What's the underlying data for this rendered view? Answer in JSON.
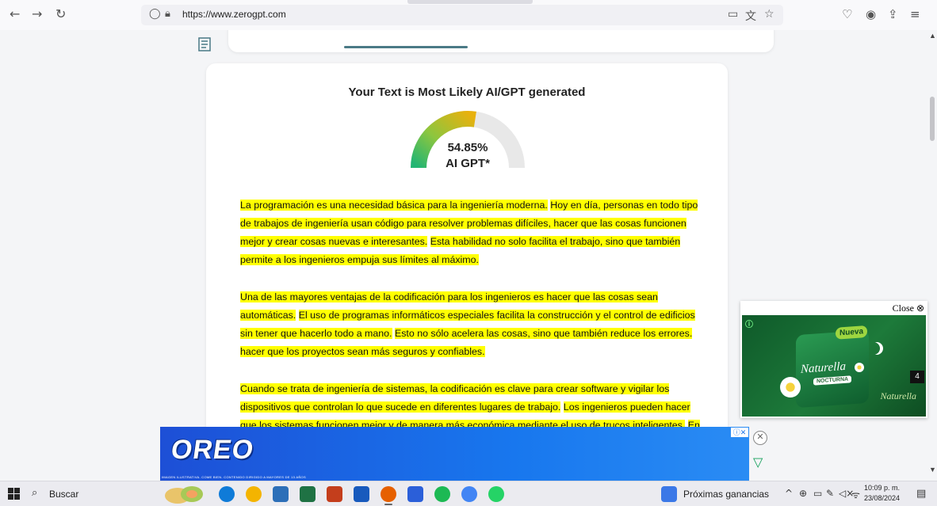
{
  "browser": {
    "back_icon": "arrow-left-icon",
    "forward_icon": "arrow-right-icon",
    "reload_icon": "reload-icon",
    "url": "https://www.zerogpt.com"
  },
  "result": {
    "title": "Your Text is Most Likely AI/GPT generated",
    "percentage": "54.85%",
    "percentage_value": 54.85,
    "gauge_label": "AI GPT*",
    "gauge_colors": [
      "#22b573",
      "#8cc63f",
      "#e8b10e",
      "#e8e8e8"
    ]
  },
  "paragraphs": [
    [
      {
        "text": "La programación es una necesidad básica para la ingeniería moderna.",
        "hl": true
      },
      {
        "text": " ",
        "hl": false
      },
      {
        "text": "Hoy en día, personas en todo tipo de trabajos de ingeniería usan código para resolver problemas difíciles, hacer que las cosas funcionen mejor y crear cosas nuevas e interesantes.",
        "hl": true
      },
      {
        "text": " ",
        "hl": false
      },
      {
        "text": "Esta habilidad no solo facilita el trabajo, sino que también permite a los ingenieros empuja sus límites al máximo.",
        "hl": true
      }
    ],
    [
      {
        "text": "Una de las mayores ventajas de la codificación para los ingenieros es hacer que las cosas sean automáticas.",
        "hl": true
      },
      {
        "text": " ",
        "hl": false
      },
      {
        "text": "El uso de programas informáticos especiales facilita la construcción y el control de edificios sin tener que hacerlo todo a mano.",
        "hl": true
      },
      {
        "text": " ",
        "hl": false
      },
      {
        "text": "Esto no sólo acelera las cosas, sino que también reduce los errores. hacer que los proyectos sean más seguros y confiables.",
        "hl": true
      }
    ],
    [
      {
        "text": "Cuando se trata de ingeniería de sistemas, la codificación es clave para crear software y vigilar los dispositivos que controlan lo que sucede en diferentes lugares de trabajo.",
        "hl": true
      },
      {
        "text": " ",
        "hl": false
      },
      {
        "text": "Los ingenieros pueden hacer que los sistemas funcionen mejor y de manera más económica mediante el uso de trucos inteligentes.",
        "hl": true
      },
      {
        "text": " ",
        "hl": false
      },
      {
        "text": "En",
        "hl": true
      }
    ]
  ],
  "video_ad": {
    "close_label": "Close ⊗",
    "info": "ⓘ",
    "badge": "Nueva",
    "brand": "Naturella",
    "sub": "NOCTURNA",
    "counter": "4"
  },
  "bottom_ad": {
    "brand": "OREO",
    "disclaimer": "IMAGEN ILUSTRATIVA. COME BIEN. CONTENIDO DIRIGIDO A MAYORES DE 13 AÑOS",
    "adchoices": "ⓘ✕"
  },
  "taskbar": {
    "search_label": "Buscar",
    "news_label": "Próximas ganancias",
    "time": "10:09 p. m.",
    "date": "23/08/2024",
    "app_colors": [
      "#0f7bd8",
      "#f4b400",
      "#2d6fb8",
      "#1f7244",
      "#c43e1c",
      "#185abd",
      "#e66000",
      "#2b5fd9",
      "#1db954",
      "#4285f4",
      "#25d366"
    ]
  }
}
